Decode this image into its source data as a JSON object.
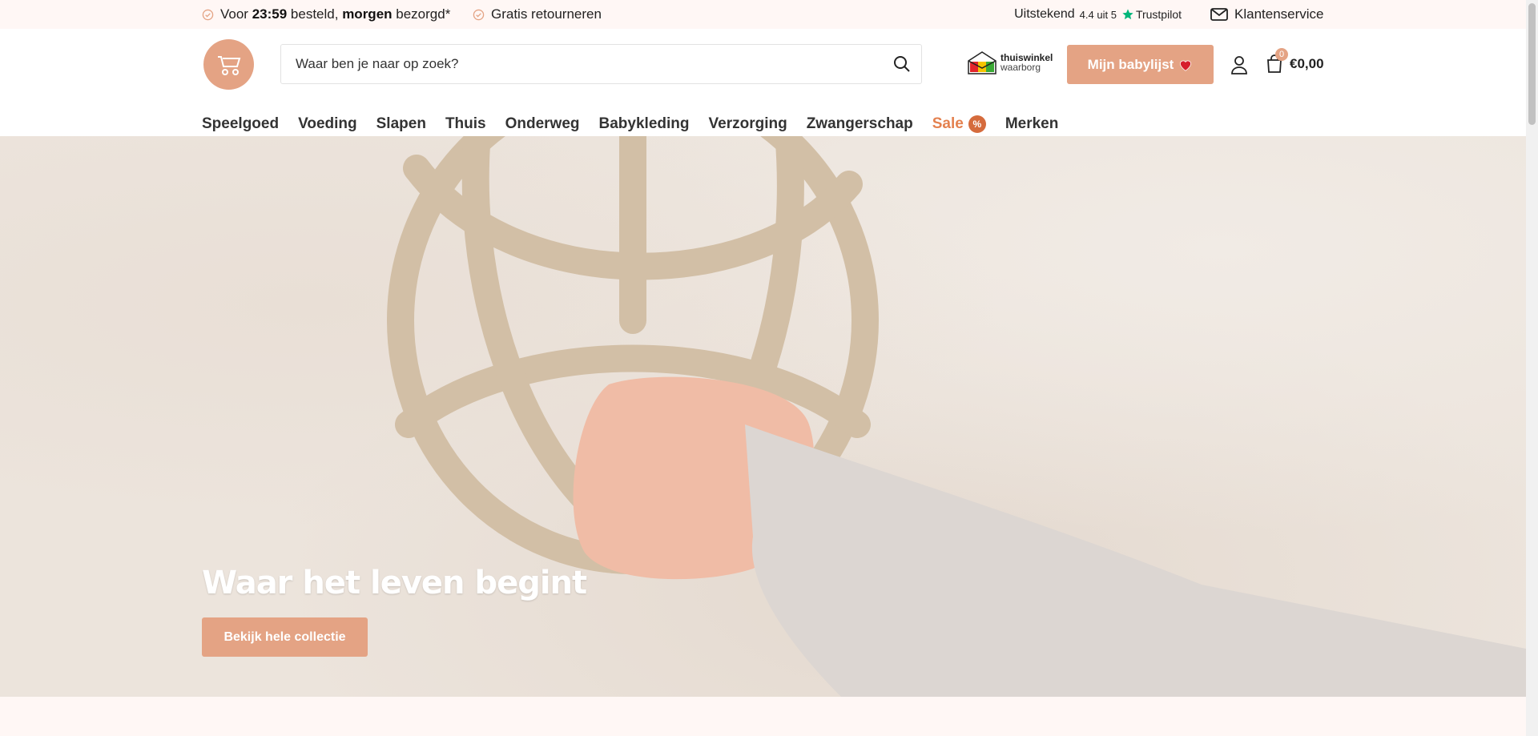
{
  "topbar": {
    "usp1": {
      "prefix": "Voor ",
      "time": "23:59",
      "mid": " besteld, ",
      "day": "morgen",
      "suffix": " bezorgd*"
    },
    "usp2": "Gratis retourneren",
    "trust_label": "Uitstekend",
    "trust_score": "4.4 uit 5",
    "trust_brand": "Trustpilot",
    "service": "Klantenservice"
  },
  "header": {
    "search_placeholder": "Waar ben je naar op zoek?",
    "thuiswinkel_1": "thuiswinkel",
    "thuiswinkel_2": "waarborg",
    "babylist_label": "Mijn babylijst",
    "cart_count": "0",
    "cart_total": "€0,00"
  },
  "nav": {
    "items": [
      "Speelgoed",
      "Voeding",
      "Slapen",
      "Thuis",
      "Onderweg",
      "Babykleding",
      "Verzorging",
      "Zwangerschap",
      "Sale",
      "Merken"
    ],
    "sale_badge": "%"
  },
  "hero": {
    "title": "Waar het leven begint",
    "button": "Bekijk hele collectie"
  },
  "colors": {
    "accent": "#e4a384",
    "sale": "#e4814f",
    "topbar_bg": "#fff7f5"
  }
}
